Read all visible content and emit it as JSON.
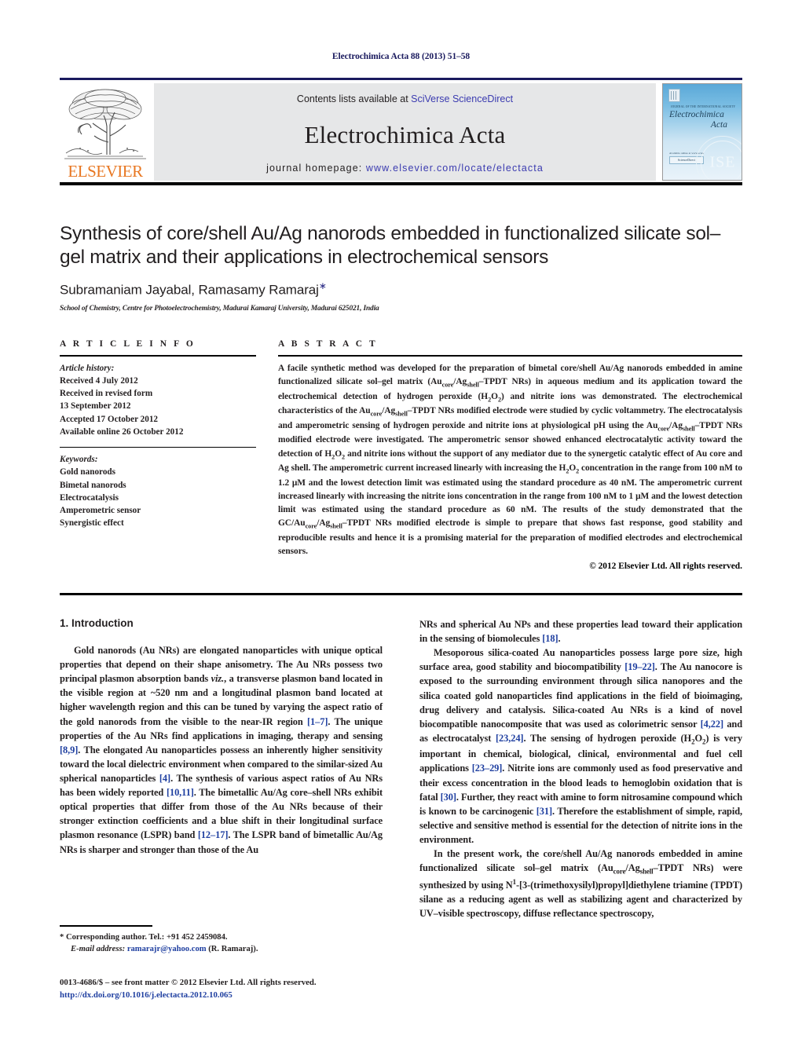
{
  "running_head": "Electrochimica Acta 88 (2013) 51–58",
  "masthead": {
    "publisher_logo_word": "ELSEVIER",
    "contents_prefix": "Contents lists available at ",
    "contents_link": "SciVerse ScienceDirect",
    "journal_title": "Electrochimica Acta",
    "homepage_prefix": "journal homepage: ",
    "homepage_url": "www.elsevier.com/locate/electacta",
    "cover": {
      "society_line": "JOURNAL OF THE INTERNATIONAL SOCIETY OF ELECTROCHEMISTRY",
      "title_line1": "Electrochimica",
      "title_line2": "Acta",
      "sd_caption": "Available online at www.sciencedirect.com",
      "sd_box": "ScienceDirect",
      "seal_text": "ISE"
    }
  },
  "article": {
    "title": "Synthesis of core/shell Au/Ag nanorods embedded in functionalized silicate sol–gel matrix and their applications in electrochemical sensors",
    "authors": "Subramaniam Jayabal, Ramasamy Ramaraj",
    "corresponding_marker": "∗",
    "affiliation": "School of Chemistry, Centre for Photoelectrochemistry, Madurai Kamaraj University, Madurai 625021, India"
  },
  "article_info": {
    "heading": "A R T I C L E   I N F O",
    "history_label": "Article history:",
    "history": [
      "Received 4 July 2012",
      "Received in revised form",
      "13 September 2012",
      "Accepted 17 October 2012",
      "Available online 26 October 2012"
    ],
    "keywords_label": "Keywords:",
    "keywords": [
      "Gold nanorods",
      "Bimetal nanorods",
      "Electrocatalysis",
      "Amperometric sensor",
      "Synergistic effect"
    ]
  },
  "abstract": {
    "heading": "A B S T R A C T",
    "paragraphs": [
      "A facile synthetic method was developed for the preparation of bimetal core/shell Au/Ag nanorods embedded in amine functionalized silicate sol–gel matrix (Aucore/Agshell–TPDT NRs) in aqueous medium and its application toward the electrochemical detection of hydrogen peroxide (H2O2) and nitrite ions was demonstrated. The electrochemical characteristics of the Aucore/Agshell–TPDT NRs modified electrode were studied by cyclic voltammetry. The electrocatalysis and amperometric sensing of hydrogen peroxide and nitrite ions at physiological pH using the Aucore/Agshell–TPDT NRs modified electrode were investigated. The amperometric sensor showed enhanced electrocatalytic activity toward the detection of H2O2 and nitrite ions without the support of any mediator due to the synergetic catalytic effect of Au core and Ag shell. The amperometric current increased linearly with increasing the H2O2 concentration in the range from 100 nM to 1.2 μM and the lowest detection limit was estimated using the standard procedure as 40 nM. The amperometric current increased linearly with increasing the nitrite ions concentration in the range from 100 nM to 1 μM and the lowest detection limit was estimated using the standard procedure as 60 nM. The results of the study demonstrated that the GC/Aucore/Agshell–TPDT NRs modified electrode is simple to prepare that shows fast response, good stability and reproducible results and hence it is a promising material for the preparation of modified electrodes and electrochemical sensors."
    ],
    "copyright": "© 2012 Elsevier Ltd. All rights reserved."
  },
  "introduction": {
    "heading": "1.  Introduction"
  },
  "footnote": {
    "corresponding": "* Corresponding author. Tel.: +91 452 2459084.",
    "email_label": "E-mail address:",
    "email": "ramarajr@yahoo.com",
    "email_suffix": "(R. Ramaraj)."
  },
  "imprint": {
    "line1": "0013-4686/$ – see front matter © 2012 Elsevier Ltd. All rights reserved.",
    "doi": "http://dx.doi.org/10.1016/j.electacta.2012.10.065"
  },
  "colors": {
    "link_blue": "#1f3fa0",
    "masthead_blue": "#3b3bb0",
    "elsevier_orange": "#E87722",
    "cover_blue": "#5aa8d8"
  }
}
